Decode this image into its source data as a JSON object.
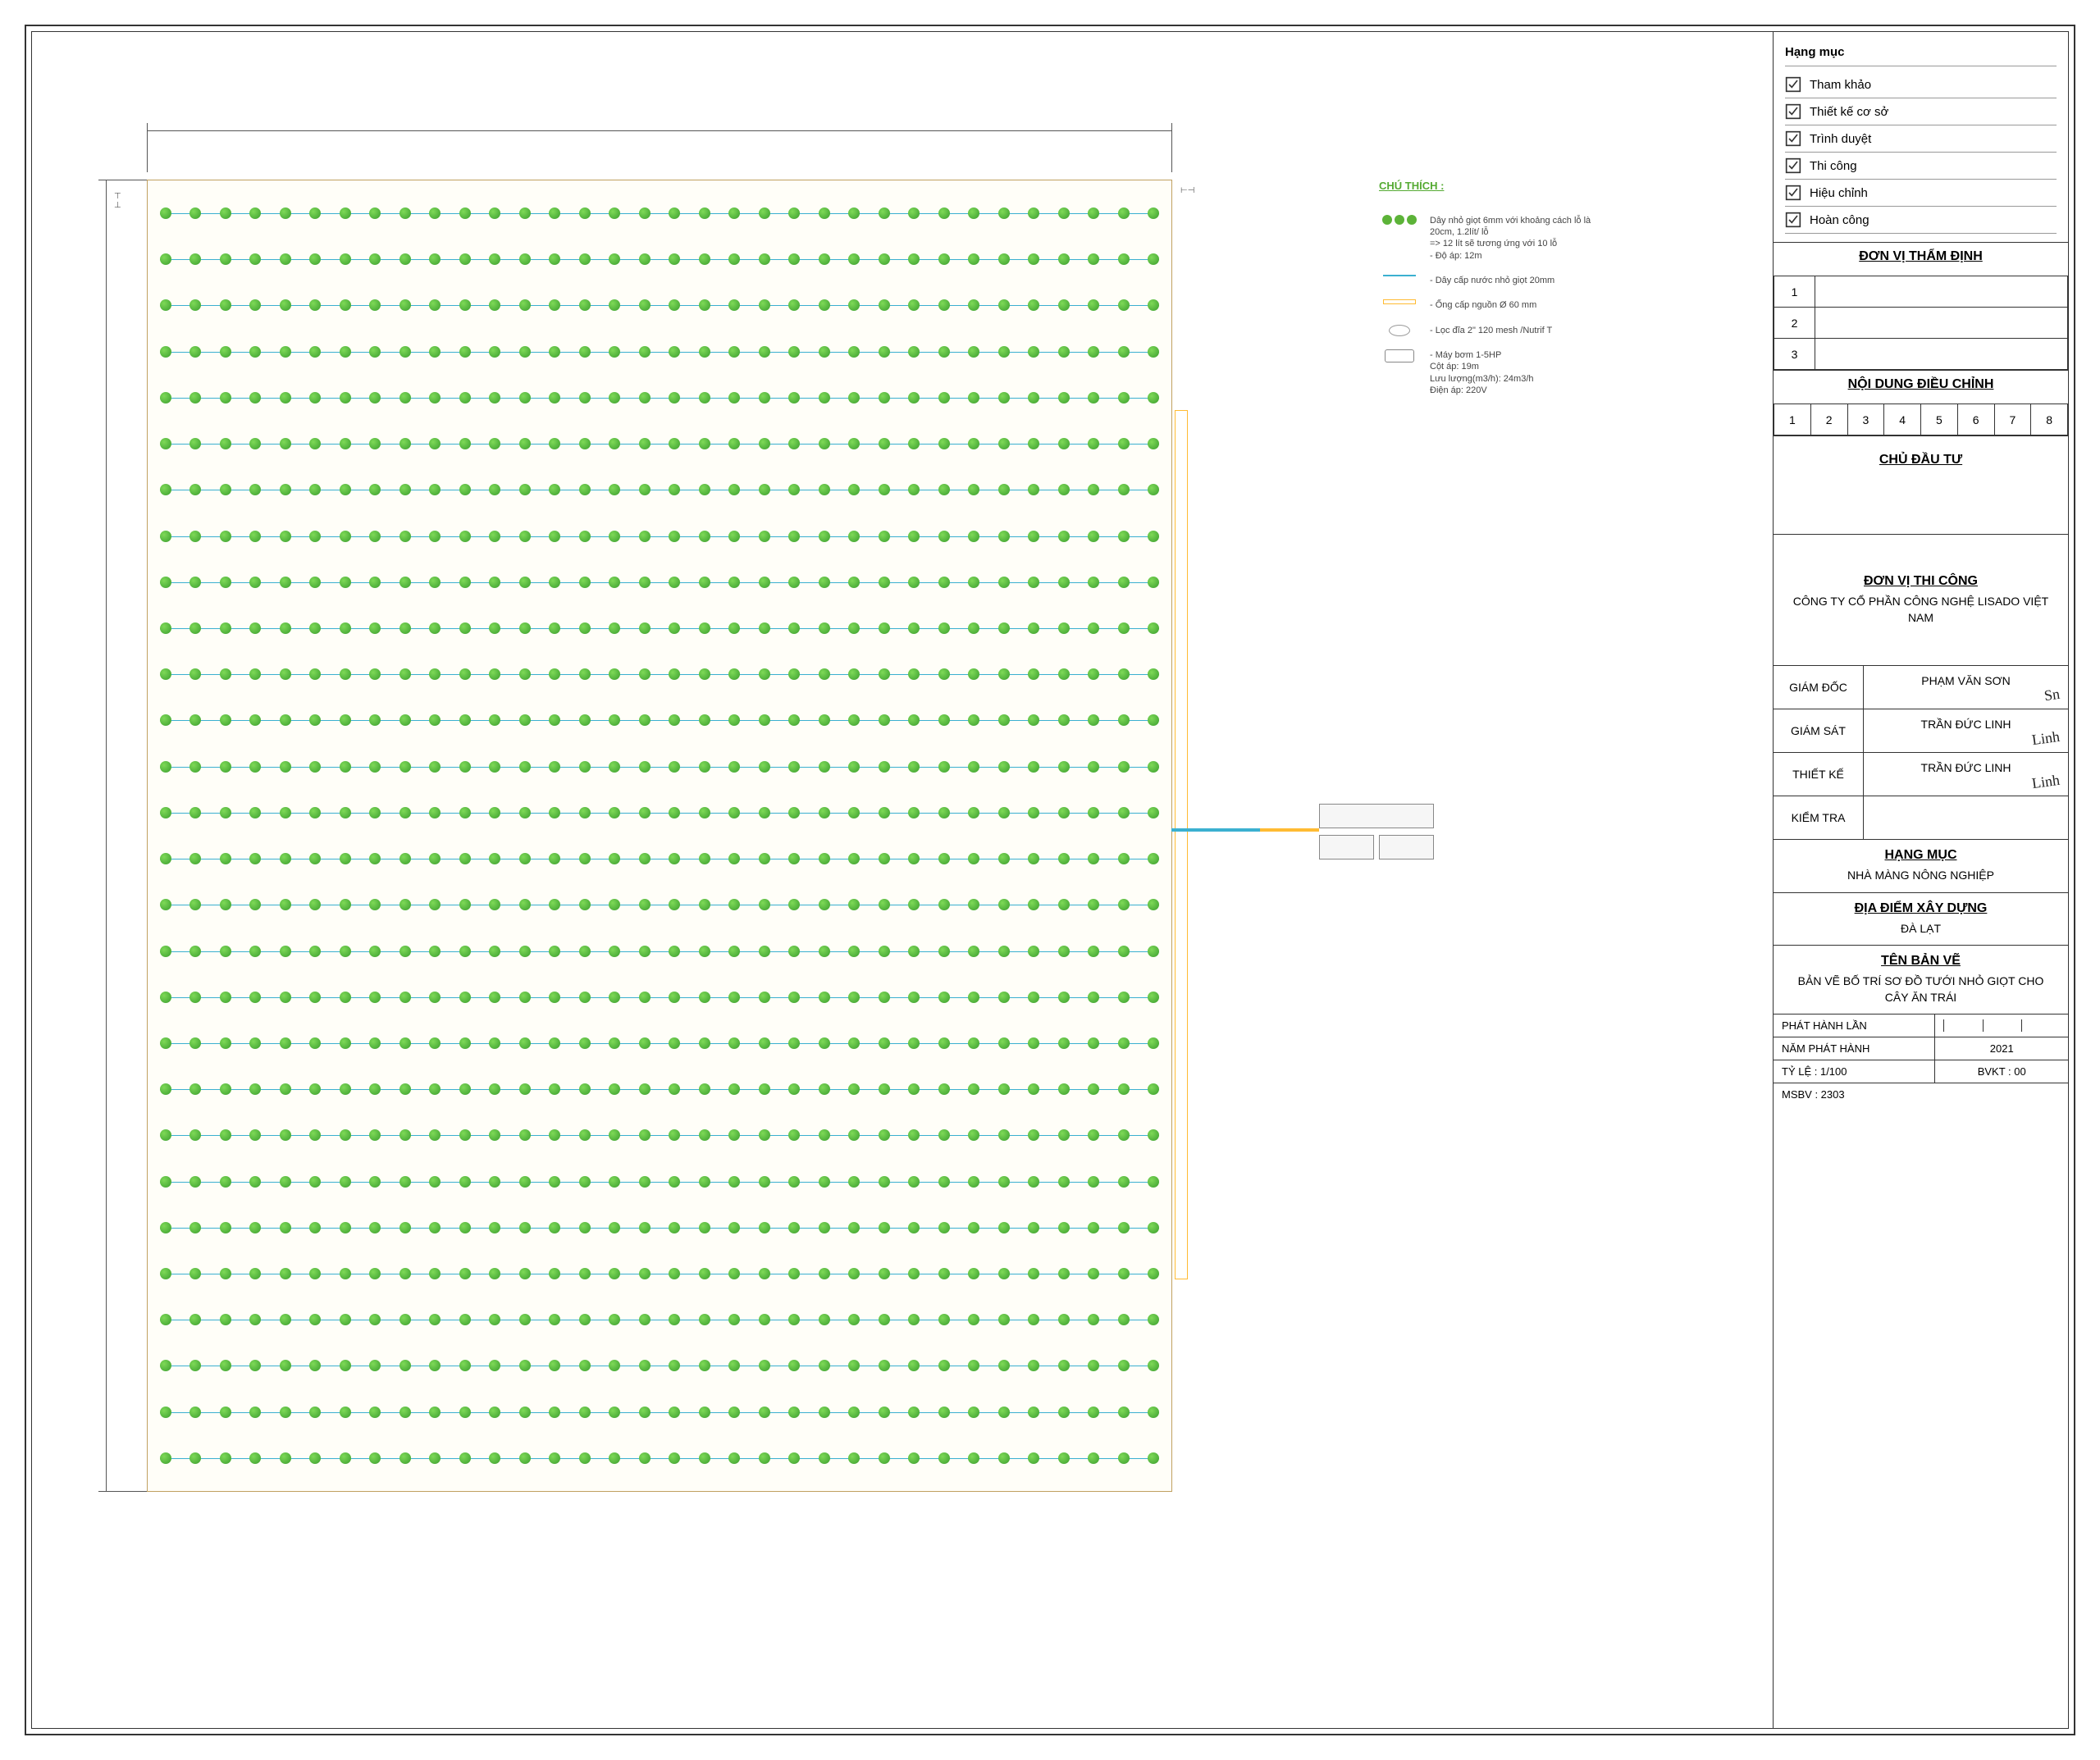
{
  "dimensions": {
    "top": "",
    "left": ""
  },
  "legend": {
    "title": "CHÚ THÍCH :",
    "items": [
      {
        "sym": "dripper-row",
        "text": "Dây nhỏ giọt 6mm với khoảng cách lỗ là 20cm, 1.2lít/ lỗ\n=> 12 lít sẽ tương ứng với 10 lỗ\n- Độ áp: 12m"
      },
      {
        "sym": "blue",
        "text": "- Dây cấp nước nhỏ giọt 20mm"
      },
      {
        "sym": "orange",
        "text": "- Ống cấp nguồn Ø 60 mm"
      },
      {
        "sym": "filter",
        "text": "- Lọc đĩa 2\" 120 mesh /Nutrif T"
      },
      {
        "sym": "pump",
        "text": "- Máy bơm 1-5HP\nCột áp: 19m\nLưu lượng(m3/h): 24m3/h\nĐiện áp: 220V"
      }
    ]
  },
  "titleblock": {
    "hangmuc_title": "Hạng mục",
    "checklist": [
      "Tham khảo",
      "Thiết kế cơ sở",
      "Trình duyệt",
      "Thi công",
      "Hiệu chỉnh",
      "Hoàn công"
    ],
    "donvithamdinh": {
      "title": "ĐƠN VỊ THẨM ĐỊNH",
      "rows": [
        "1",
        "2",
        "3"
      ]
    },
    "noidung": {
      "title": "NỘI DUNG ĐIỀU CHỈNH",
      "cols": [
        "1",
        "2",
        "3",
        "4",
        "5",
        "6",
        "7",
        "8"
      ]
    },
    "chudautu": "CHỦ ĐẦU TƯ",
    "donvithicong": {
      "title": "ĐƠN VỊ THI CÔNG",
      "name": "CÔNG TY CỔ PHẦN CÔNG NGHỆ LISADO VIỆT NAM"
    },
    "signatures": [
      {
        "role": "GIÁM ĐỐC",
        "name": "PHẠM VĂN SƠN",
        "sig": "Sn"
      },
      {
        "role": "GIÁM SÁT",
        "name": "TRẦN ĐỨC LINH",
        "sig": "Linh"
      },
      {
        "role": "THIẾT KẾ",
        "name": "TRẦN ĐỨC LINH",
        "sig": "Linh"
      },
      {
        "role": "KIỂM TRA",
        "name": "",
        "sig": ""
      }
    ],
    "hangmuc2": {
      "title": "HẠNG MỤC",
      "value": "NHÀ MÀNG NÔNG NGHIỆP"
    },
    "diadiem": {
      "title": "ĐỊA ĐIỂM XÂY DỰNG",
      "value": "ĐÀ LẠT"
    },
    "tenbanve": {
      "title": "TÊN BẢN VẼ",
      "value": "BẢN VẼ BỐ TRÍ SƠ ĐỒ TƯỚI NHỎ GIỌT CHO CÂY ĂN TRÁI"
    },
    "footer": {
      "phathanh": "PHÁT HÀNH LẦN",
      "namphathanh_l": "NĂM PHÁT HÀNH",
      "namphathanh_v": "2021",
      "tyle_l": "TỶ LỆ : 1/100",
      "tyle_v": "BVKT : 00",
      "msbv": "MSBV : 2303"
    }
  },
  "grid": {
    "rows": 28,
    "cols": 34
  }
}
